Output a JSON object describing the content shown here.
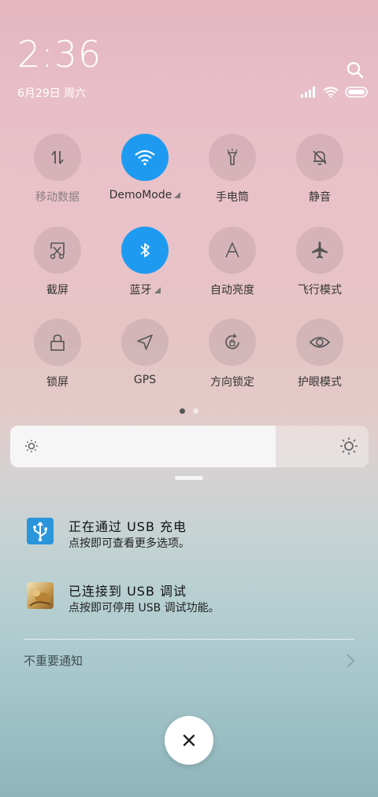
{
  "status": {
    "time": "2:36",
    "date": "6月29日 周六"
  },
  "tiles": [
    {
      "label": "移动数据",
      "icon": "mobile-data-icon",
      "active": false,
      "dim": true
    },
    {
      "label": "DemoMode",
      "icon": "wifi-icon",
      "active": true,
      "expandable": true
    },
    {
      "label": "手电筒",
      "icon": "flashlight-icon",
      "active": false
    },
    {
      "label": "静音",
      "icon": "mute-bell-icon",
      "active": false
    },
    {
      "label": "截屏",
      "icon": "screenshot-icon",
      "active": false
    },
    {
      "label": "蓝牙",
      "icon": "bluetooth-icon",
      "active": true,
      "expandable": true
    },
    {
      "label": "自动亮度",
      "icon": "auto-brightness-icon",
      "active": false
    },
    {
      "label": "飞行模式",
      "icon": "airplane-icon",
      "active": false
    },
    {
      "label": "锁屏",
      "icon": "lock-icon",
      "active": false
    },
    {
      "label": "GPS",
      "icon": "gps-icon",
      "active": false
    },
    {
      "label": "方向锁定",
      "icon": "rotation-lock-icon",
      "active": false
    },
    {
      "label": "护眼模式",
      "icon": "eye-icon",
      "active": false
    }
  ],
  "pager": {
    "pages": 2,
    "current": 1
  },
  "brightness": {
    "level": 0.74
  },
  "notifications": [
    {
      "title": "正在通过 USB 充电",
      "subtitle": "点按即可查看更多选项。",
      "icon": "usb-icon"
    },
    {
      "title": "已连接到 USB 调试",
      "subtitle": "点按即可停用 USB 调试功能。",
      "icon": "app-thumbnail-icon"
    }
  ],
  "unimportant_label": "不重要通知",
  "colors": {
    "accent": "#1e9bf0"
  }
}
